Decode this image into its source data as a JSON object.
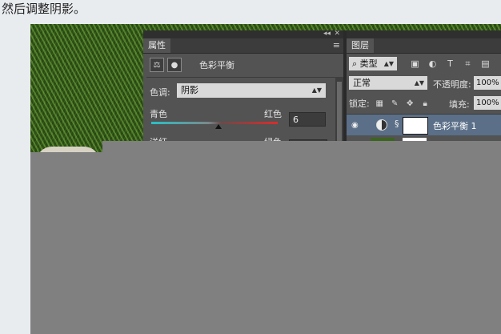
{
  "instruction": "然后调整阴影。",
  "properties_panel": {
    "tab": "属性",
    "menu": "≡",
    "title": "色彩平衡",
    "tone_label": "色调:",
    "tone_value": "阴影",
    "slider_left_label": "青色",
    "slider_right_label": "红色",
    "slider_value": "6",
    "slider2_left_label": "洋红",
    "slider2_right_label": "绿色"
  },
  "layers_panel": {
    "tab": "图层",
    "menu": "≡",
    "filter_value": "类型",
    "blend_mode": "正常",
    "opacity_label": "不透明度:",
    "opacity_value": "100%",
    "lock_label": "锁定:",
    "fill_label": "填充:",
    "fill_value": "100%",
    "layer_name": "色彩平衡 1"
  },
  "colors": {
    "panel_bg": "#535353",
    "selected_layer": "#5b6f88",
    "occluder": "#808080"
  }
}
